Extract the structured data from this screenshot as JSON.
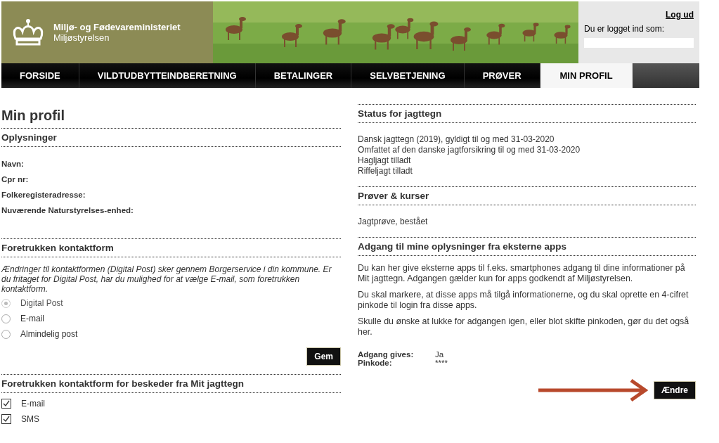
{
  "header": {
    "ministry": "Miljø- og Fødevareministeriet",
    "agency": "Miljøstyrelsen",
    "logout": "Log ud",
    "logged_in_as": "Du er logget ind som:"
  },
  "nav": [
    {
      "label": "FORSIDE",
      "selected": false
    },
    {
      "label": "VILDTUDBYTTEINDBERETNING",
      "selected": false
    },
    {
      "label": "BETALINGER",
      "selected": false
    },
    {
      "label": "SELVBETJENING",
      "selected": false
    },
    {
      "label": "PRØVER",
      "selected": false
    },
    {
      "label": "MIN PROFIL",
      "selected": true
    }
  ],
  "page_title": "Min profil",
  "left": {
    "info": {
      "title": "Oplysninger",
      "fields": [
        "Navn:",
        "Cpr nr:",
        "Folkeregisteradresse:",
        "Nuværende Naturstyrelses-enhed:"
      ]
    },
    "contact": {
      "title": "Foretrukken kontaktform",
      "note": "Ændringer til kontaktformen (Digital Post) sker gennem Borgerservice i din kommune. Er du fritaget for Digital Post, har du mulighed for at vælge E-mail, som foretrukken kontaktform.",
      "options": [
        {
          "label": "Digital Post",
          "selected": true,
          "disabled": true
        },
        {
          "label": "E-mail",
          "selected": false,
          "disabled": false
        },
        {
          "label": "Almindelig post",
          "selected": false,
          "disabled": false
        }
      ],
      "button": "Gem"
    },
    "messages": {
      "title": "Foretrukken kontaktform for beskeder fra Mit jagttegn",
      "options": [
        {
          "label": "E-mail",
          "checked": true
        },
        {
          "label": "SMS",
          "checked": true
        }
      ]
    }
  },
  "right": {
    "status": {
      "title": "Status for jagttegn",
      "lines": [
        "Dansk jagttegn (2019), gyldigt til og med 31-03-2020",
        "Omfattet af den danske jagtforsikring til og med 31-03-2020",
        "Hagljagt tilladt",
        "Riffeljagt tilladt"
      ]
    },
    "courses": {
      "title": "Prøver & kurser",
      "lines": [
        "Jagtprøve, bestået"
      ]
    },
    "apps": {
      "title": "Adgang til mine oplysninger fra eksterne apps",
      "paragraphs": [
        "Du kan her give eksterne apps til f.eks. smartphones adgang til dine informationer på Mit jagttegn. Adgangen gælder kun for apps godkendt af Miljøstyrelsen.",
        "Du skal markere, at disse apps må tilgå informationerne, og du skal oprette en 4-cifret pinkode til login fra disse apps.",
        "Skulle du ønske at lukke for adgangen igen, eller blot skifte pinkoden, gør du det også her."
      ],
      "facts": [
        {
          "label": "Adgang gives:",
          "value": "Ja"
        },
        {
          "label": "Pinkode:",
          "value": "****"
        }
      ],
      "button": "Ændre"
    }
  }
}
